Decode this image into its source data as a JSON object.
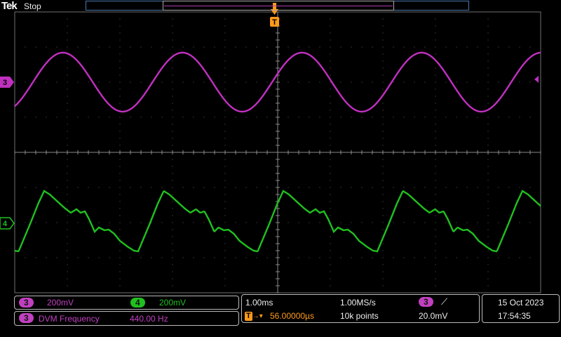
{
  "header": {
    "brand": "Tek",
    "status": "Stop"
  },
  "trigger_marker": "T",
  "channels": {
    "ch3": {
      "number": "3",
      "scale": "200mV",
      "color": "#c030c0"
    },
    "ch4": {
      "number": "4",
      "scale": "200mV",
      "color": "#20c020"
    }
  },
  "measurement": {
    "channel": "3",
    "label": "DVM Frequency",
    "value": "440.00 Hz"
  },
  "timebase": {
    "scale": "1.00ms",
    "sample_rate": "1.00MS/s",
    "trigger_badge": "T",
    "position": "56.00000µs",
    "record_length": "10k points"
  },
  "trigger": {
    "source": "3",
    "slope_symbol": "⟋",
    "level": "20.0mV"
  },
  "datetime": {
    "date": "15 Oct  2023",
    "time": "17:54:35"
  }
}
